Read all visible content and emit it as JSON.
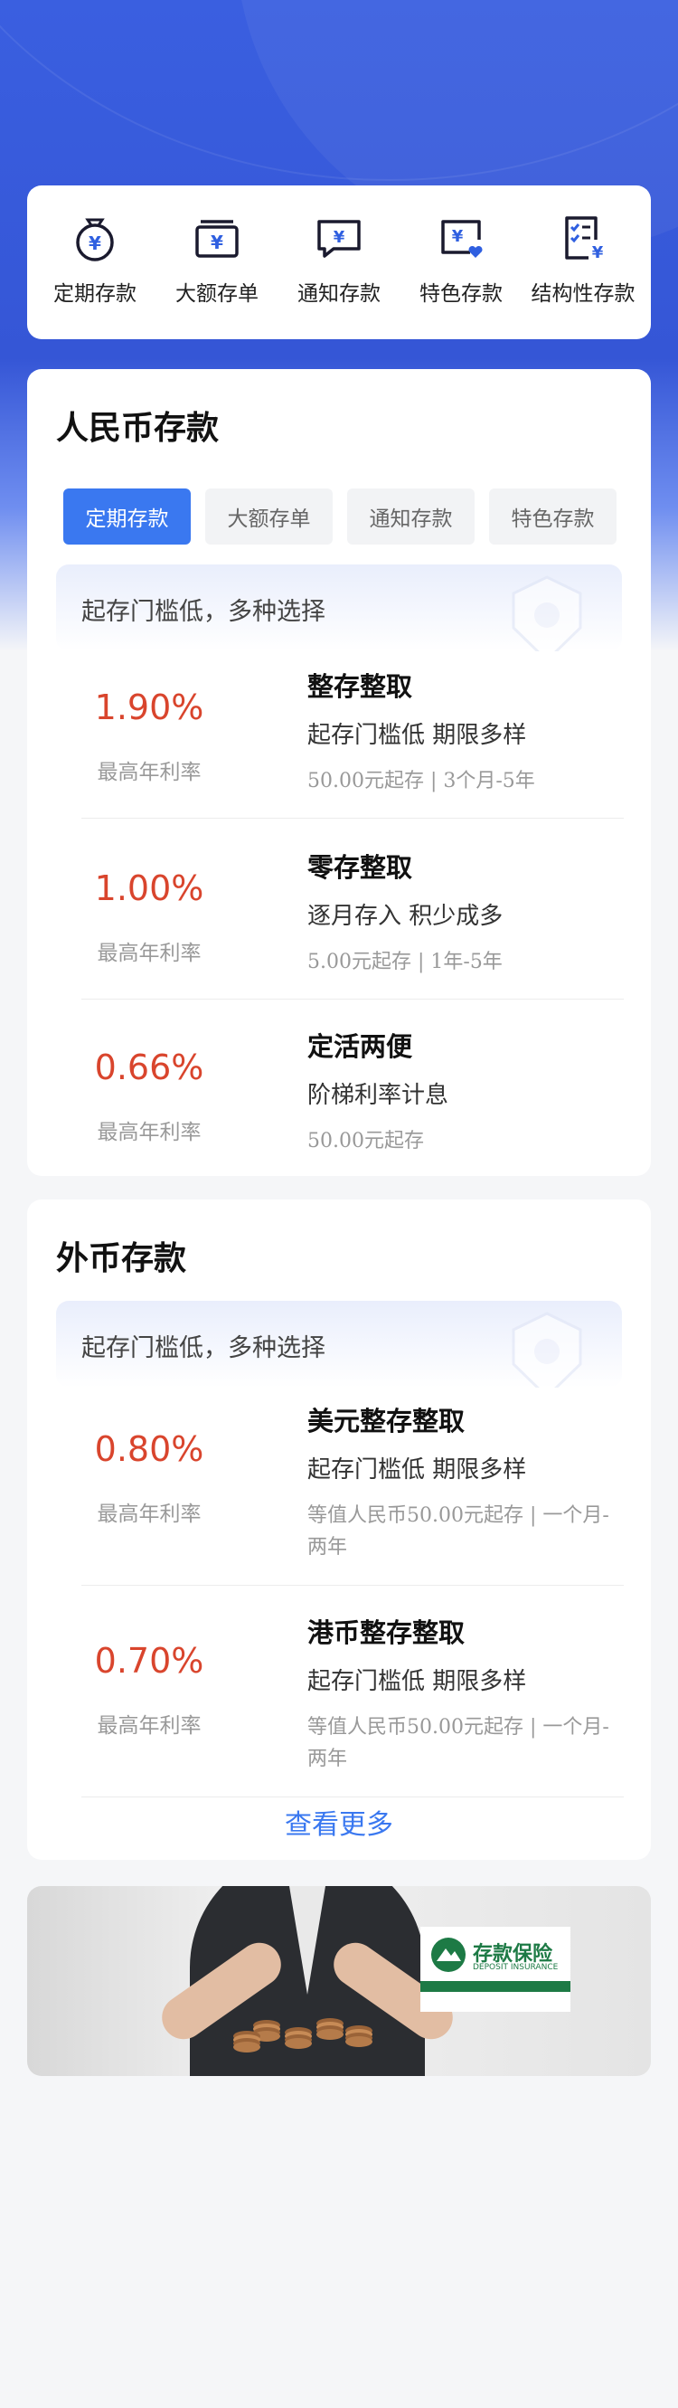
{
  "colors": {
    "primary": "#3a78f0",
    "rate": "#d9452d",
    "hero": "#3556d6"
  },
  "quick_menu": [
    {
      "label": "定期存款",
      "icon": "moneybag-icon"
    },
    {
      "label": "大额存单",
      "icon": "deposit-box-icon"
    },
    {
      "label": "通知存款",
      "icon": "message-yuan-icon"
    },
    {
      "label": "特色存款",
      "icon": "yuan-heart-icon"
    },
    {
      "label": "结构性存款",
      "icon": "checklist-yuan-icon"
    }
  ],
  "rmb": {
    "title": "人民币存款",
    "tabs": [
      "定期存款",
      "大额存单",
      "通知存款",
      "特色存款"
    ],
    "active_tab": 0,
    "banner": "起存门槛低，多种选择",
    "products": [
      {
        "rate": "1.90%",
        "rate_label": "最高年利率",
        "name": "整存整取",
        "features": "起存门槛低  期限多样",
        "meta": "50.00元起存 | 3个月-5年"
      },
      {
        "rate": "1.00%",
        "rate_label": "最高年利率",
        "name": "零存整取",
        "features": "逐月存入  积少成多",
        "meta": "5.00元起存 | 1年-5年"
      },
      {
        "rate": "0.66%",
        "rate_label": "最高年利率",
        "name": "定活两便",
        "features": "阶梯利率计息",
        "meta": "50.00元起存"
      }
    ]
  },
  "foreign": {
    "title": "外币存款",
    "banner": "起存门槛低，多种选择",
    "products": [
      {
        "rate": "0.80%",
        "rate_label": "最高年利率",
        "name": "美元整存整取",
        "features": "起存门槛低  期限多样",
        "meta": "等值人民币50.00元起存 | 一个月-两年"
      },
      {
        "rate": "0.70%",
        "rate_label": "最高年利率",
        "name": "港币整存整取",
        "features": "起存门槛低  期限多样",
        "meta": "等值人民币50.00元起存 | 一个月-两年"
      }
    ],
    "more": "查看更多"
  },
  "insurance": {
    "logo_title": "存款保险",
    "logo_sub": "DEPOSIT INSURANCE"
  }
}
